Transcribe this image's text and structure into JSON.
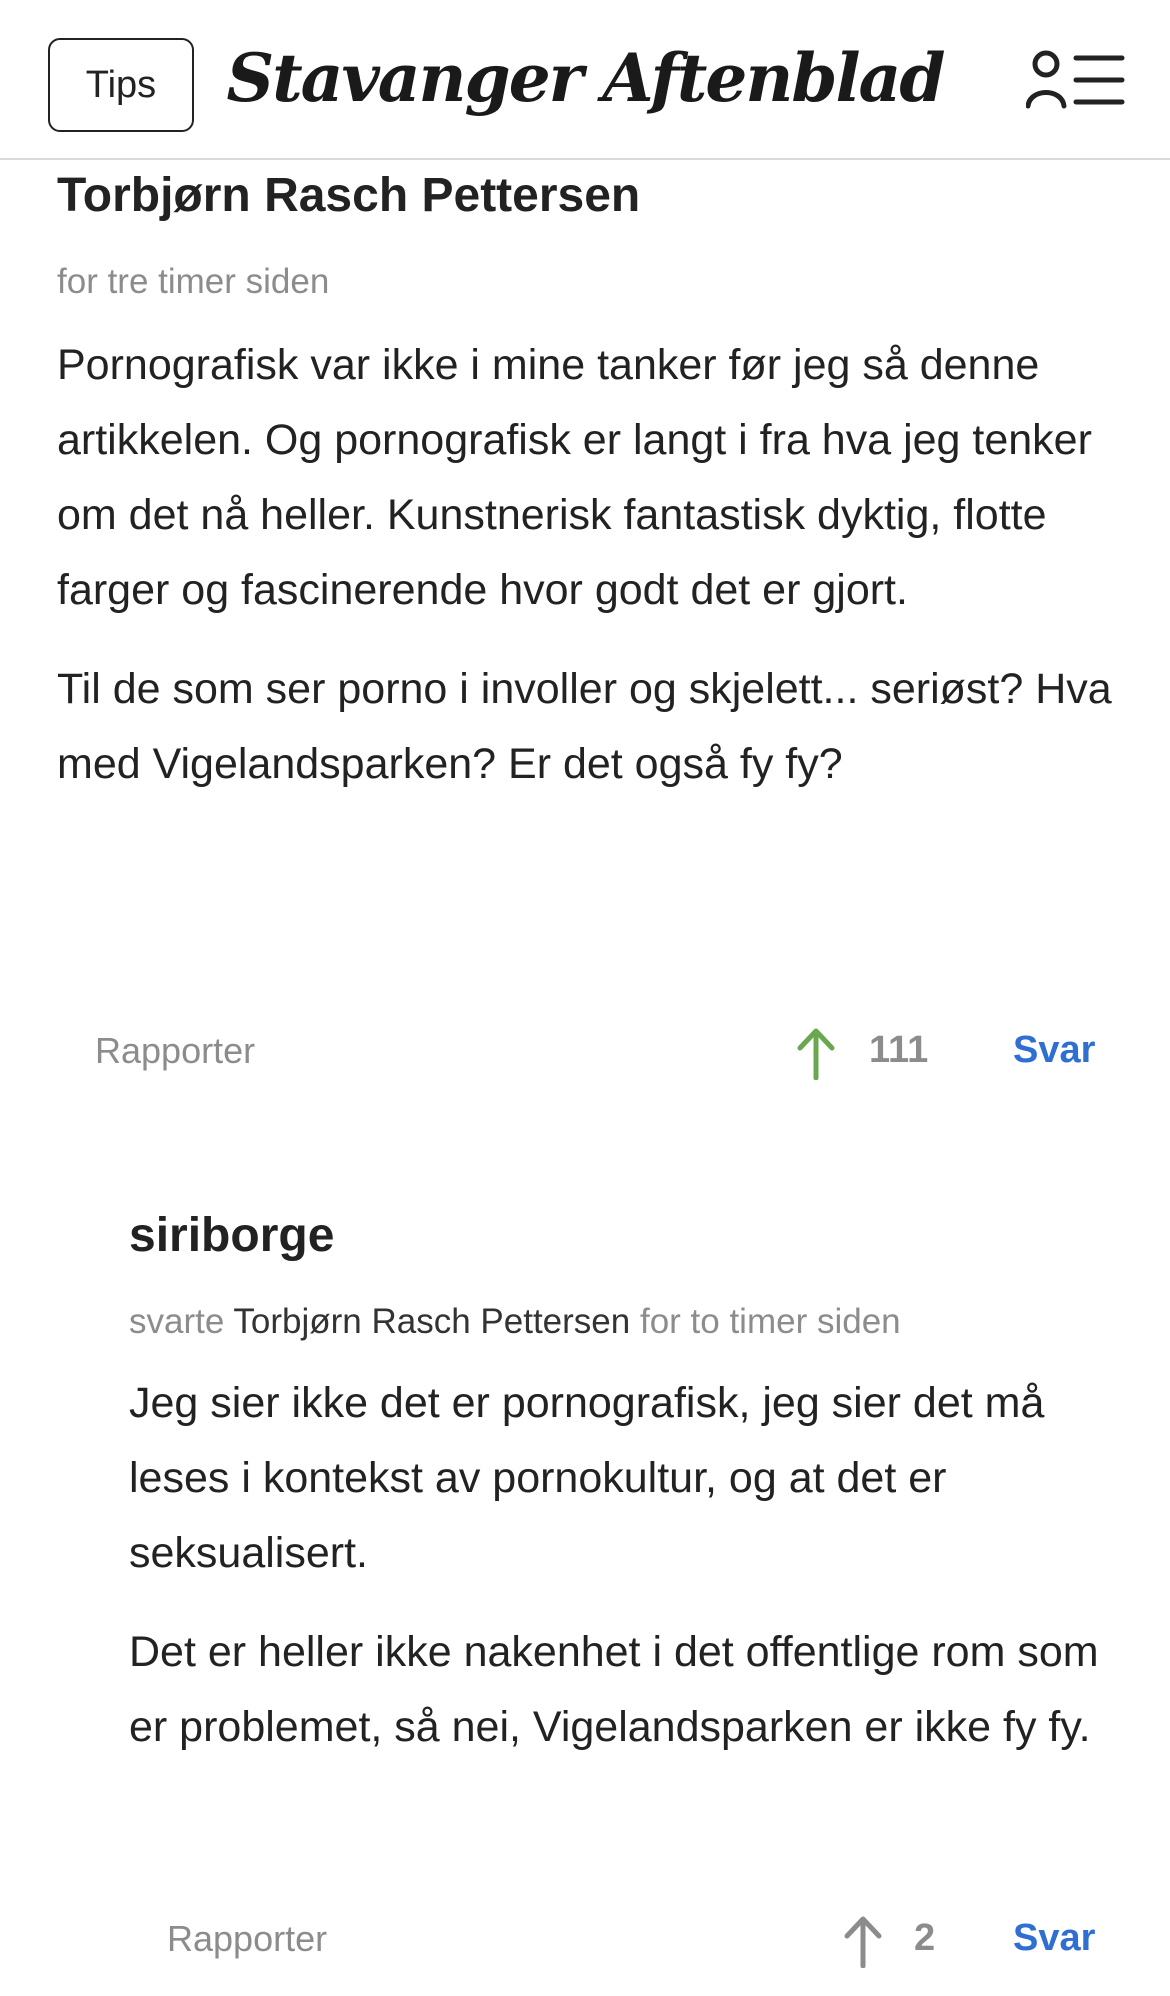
{
  "header": {
    "tips_label": "Tips",
    "logo_text": "Stavanger Aftenblad",
    "menu_icon": "user-menu-icon"
  },
  "comments": [
    {
      "author": "Torbjørn Rasch Pettersen",
      "time": "for tre timer siden",
      "paragraphs": [
        "Pornografisk var ikke i mine tanker før jeg så denne artikkelen. Og pornografisk er langt i fra hva jeg tenker om det nå heller. Kunstnerisk fantastisk dyktig, flotte farger og fascinerende hvor godt det er gjort.",
        "Til de som ser porno i involler og skjelett... seriøst? Hva med Vigelandsparken? Er det også fy fy?"
      ],
      "report_label": "Rapporter",
      "upvotes": "111",
      "upvote_color": "#6aa84f",
      "reply_label": "Svar"
    },
    {
      "author": "siriborge",
      "replied_prefix": "svarte",
      "replied_to": "Torbjørn Rasch Pettersen",
      "time": "for to timer siden",
      "paragraphs": [
        "Jeg sier ikke det er pornografisk, jeg sier det må leses i kontekst av pornokultur, og at det er seksualisert.",
        "Det er heller ikke nakenhet i det offentlige rom som er problemet, så nei, Vigelandsparken er ikke fy fy."
      ],
      "report_label": "Rapporter",
      "upvotes": "2",
      "upvote_color": "#8c8c8c",
      "reply_label": "Svar"
    }
  ],
  "colors": {
    "accent_link": "#2f6fd1",
    "muted_text": "#8c8c8c"
  }
}
